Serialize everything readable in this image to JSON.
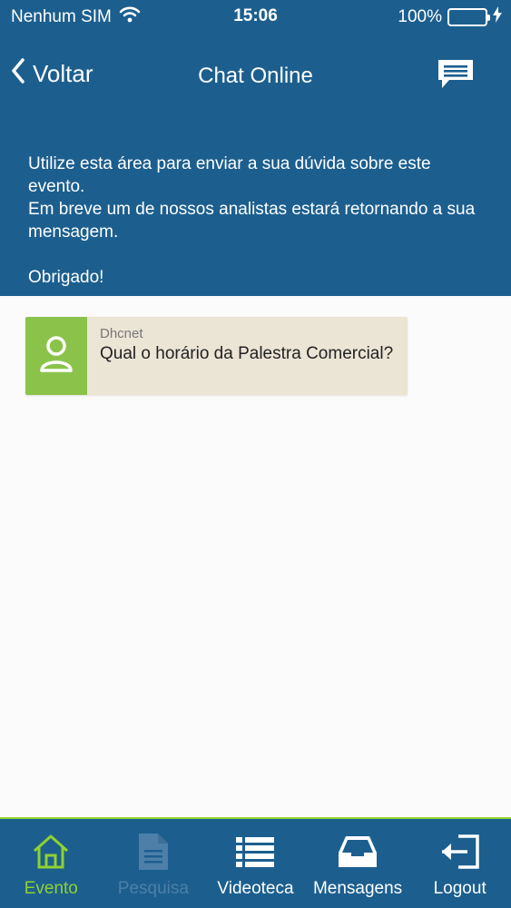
{
  "status": {
    "carrier": "Nenhum SIM",
    "time": "15:06",
    "battery": "100%"
  },
  "nav": {
    "back_label": "Voltar",
    "title": "Chat Online"
  },
  "intro": {
    "line1": "Utilize esta área para enviar a sua dúvida sobre este evento.",
    "line2": "Em breve um de nossos analistas estará retornando a sua mensagem.",
    "thanks": "Obrigado!"
  },
  "messages": [
    {
      "sender": "Dhcnet",
      "text": "Qual o horário da Palestra Comercial?"
    }
  ],
  "tabs": [
    {
      "label": "Evento",
      "icon": "home-icon",
      "state": "active"
    },
    {
      "label": "Pesquisa",
      "icon": "document-icon",
      "state": "disabled"
    },
    {
      "label": "Videoteca",
      "icon": "list-icon",
      "state": "normal"
    },
    {
      "label": "Mensagens",
      "icon": "inbox-icon",
      "state": "normal"
    },
    {
      "label": "Logout",
      "icon": "logout-icon",
      "state": "normal"
    }
  ],
  "colors": {
    "header": "#1c5f8f",
    "accent": "#8fd22f",
    "avatar": "#8bc34a",
    "bubble": "#ebe5d6"
  }
}
